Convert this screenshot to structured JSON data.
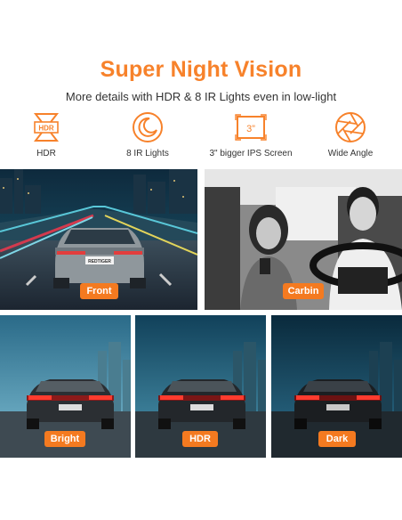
{
  "heading": {
    "title": "Super Night Vision",
    "subtitle": "More details with HDR & 8 IR Lights even in low-light"
  },
  "features": [
    {
      "icon": "hdr-icon",
      "label": "HDR",
      "icon_text": "HDR"
    },
    {
      "icon": "moon-icon",
      "label": "8 IR Lights"
    },
    {
      "icon": "screen-icon",
      "label": "3\" bigger IPS Screen",
      "icon_text": "3”"
    },
    {
      "icon": "aperture-icon",
      "label": "Wide Angle"
    }
  ],
  "photos": {
    "front": {
      "tag": "Front",
      "plate": "REDTIGER"
    },
    "cabin": {
      "tag": "Carbin"
    },
    "bright": {
      "tag": "Bright"
    },
    "hdr": {
      "tag": "HDR"
    },
    "dark": {
      "tag": "Dark"
    }
  },
  "colors": {
    "accent": "#f7822b",
    "tag_bg": "#f47a20"
  }
}
